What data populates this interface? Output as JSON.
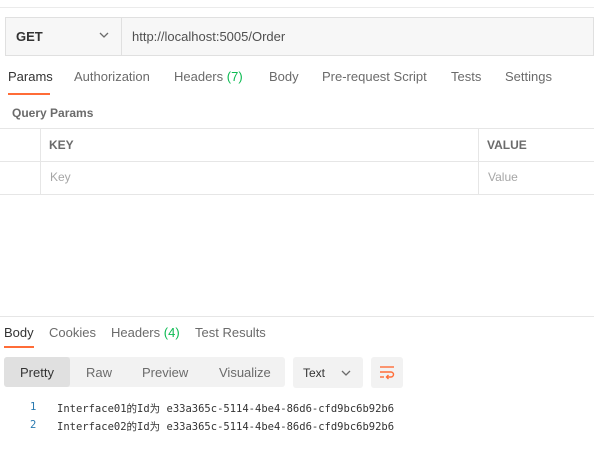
{
  "request": {
    "method": "GET",
    "url": "http://localhost:5005/Order"
  },
  "request_tabs": [
    {
      "label": "Params",
      "active": true
    },
    {
      "label": "Authorization"
    },
    {
      "label": "Headers",
      "count": "(7)"
    },
    {
      "label": "Body"
    },
    {
      "label": "Pre-request Script"
    },
    {
      "label": "Tests"
    },
    {
      "label": "Settings"
    }
  ],
  "query_params": {
    "title": "Query Params",
    "columns": [
      "KEY",
      "VALUE"
    ],
    "placeholders": {
      "key": "Key",
      "value": "Value"
    }
  },
  "response_tabs": [
    {
      "label": "Body",
      "active": true
    },
    {
      "label": "Cookies"
    },
    {
      "label": "Headers",
      "count": "(4)"
    },
    {
      "label": "Test Results"
    }
  ],
  "view_modes": [
    {
      "label": "Pretty",
      "active": true
    },
    {
      "label": "Raw"
    },
    {
      "label": "Preview"
    },
    {
      "label": "Visualize"
    }
  ],
  "format": "Text",
  "response_lines": [
    {
      "n": "1",
      "text": "Interface01的Id为 e33a365c-5114-4be4-86d6-cfd9bc6b92b6"
    },
    {
      "n": "2",
      "text": "Interface02的Id为 e33a365c-5114-4be4-86d6-cfd9bc6b92b6"
    }
  ],
  "colors": {
    "accent": "#ff6c37",
    "count_green": "#0cbb52",
    "line_number": "#2a7ab0"
  }
}
